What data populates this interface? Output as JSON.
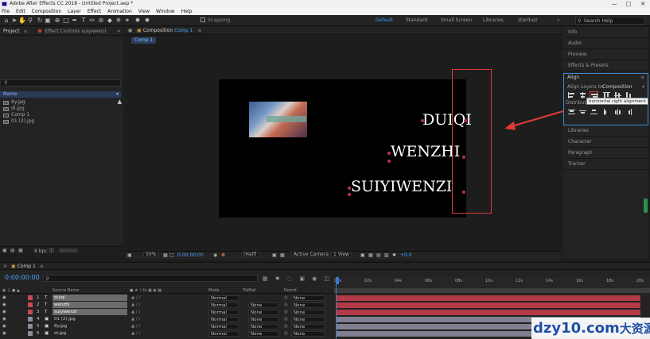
{
  "window": {
    "title": "Adobe After Effects CC 2018 - Untitled Project.aep *",
    "controls": [
      "—",
      "□",
      "✕"
    ]
  },
  "menu": [
    "File",
    "Edit",
    "Composition",
    "Layer",
    "Effect",
    "Animation",
    "View",
    "Window",
    "Help"
  ],
  "toolbar": {
    "snapping_label": "Snapping",
    "workspaces": [
      "Default",
      "Standard",
      "Small Screen",
      "Libraries",
      "stardust"
    ],
    "active_workspace": "Default",
    "search_placeholder": "Search Help"
  },
  "project_panel": {
    "tab": "Project",
    "effect_controls_tab": "Effect Controls suiyiwenzi",
    "name_header": "Name",
    "items": [
      "8y.jpg",
      "di.jpg",
      "Comp 1",
      "01 (2).jpg"
    ],
    "bpc_label": "8 bpc"
  },
  "composition_panel": {
    "tab": "Composition",
    "tab_comp": "Comp 1",
    "breadcrumb": "Comp 1",
    "text_lines": [
      "DUIQI",
      "WENZHI",
      "SUIYIWENZI"
    ],
    "footer": {
      "zoom": "50%",
      "timecode": "0:00:00:00",
      "resolution": "(Half)",
      "camera": "Active Camera",
      "view": "1 View",
      "exposure": "+0.0"
    }
  },
  "right_panel": {
    "items_top": [
      "Info",
      "Audio",
      "Preview",
      "Effects & Presets"
    ],
    "align": {
      "title": "Align",
      "align_layers_to_label": "Align Layers to:",
      "align_target": "Composition",
      "distribute_label": "Distribute",
      "tooltip": "horizontal right alignment"
    },
    "items_bottom": [
      "Libraries",
      "Character",
      "Paragraph",
      "Tracker"
    ]
  },
  "timeline": {
    "tab": "Comp 1",
    "timecode": "0:00:00:00",
    "search_placeholder": "ρ",
    "columns": {
      "source_name": "Source Name",
      "mode": "Mode",
      "trkmat": "TrkMat",
      "parent": "Parent"
    },
    "ruler": [
      "00s",
      "02s",
      "04s",
      "06s",
      "08s",
      "10s",
      "12s",
      "14s",
      "16s",
      "18s",
      "20s"
    ],
    "layers": [
      {
        "num": "1",
        "type": "T",
        "name": "duiqi",
        "mode": "Normal",
        "trkmat": "",
        "parent": "None",
        "color": "#c84a55",
        "bar": "#b23b47"
      },
      {
        "num": "2",
        "type": "T",
        "name": "wenzhi",
        "mode": "Normal",
        "trkmat": "None",
        "parent": "None",
        "color": "#c84a55",
        "bar": "#b23b47"
      },
      {
        "num": "3",
        "type": "T",
        "name": "suiyiwenzi",
        "mode": "Normal",
        "trkmat": "None",
        "parent": "None",
        "color": "#c84a55",
        "bar": "#b23b47"
      },
      {
        "num": "4",
        "type": "img",
        "name": "01 (2).jpg",
        "mode": "Normal",
        "trkmat": "None",
        "parent": "None",
        "color": "#8d8d99",
        "bar": "#7f7f8f"
      },
      {
        "num": "5",
        "type": "img",
        "name": "8y.jpg",
        "mode": "Normal",
        "trkmat": "None",
        "parent": "None",
        "color": "#8d8d99",
        "bar": "#7f7f8f"
      },
      {
        "num": "6",
        "type": "img",
        "name": "di.jpg",
        "mode": "Normal",
        "trkmat": "None",
        "parent": "None",
        "color": "#8d8d99",
        "bar": "#7f7f8f"
      }
    ]
  },
  "watermark": {
    "text": "dzy10.com",
    "cn": "大资源网"
  },
  "colors": {
    "accent": "#3aa0ff",
    "annotation": "#e03a3a",
    "text_layer": "#b23b47",
    "image_layer": "#7f7f8f"
  }
}
